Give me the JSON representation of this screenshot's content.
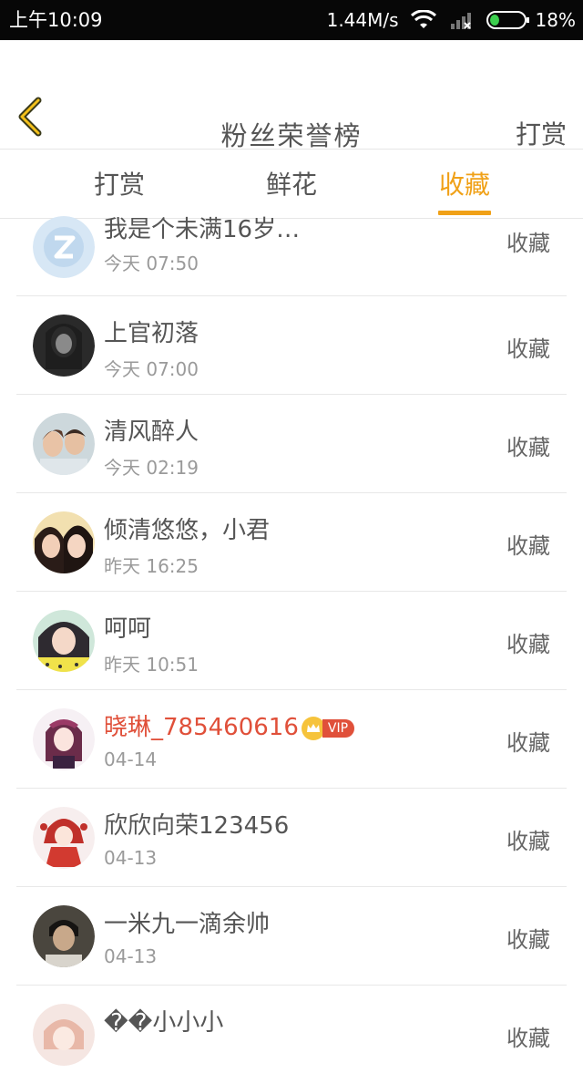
{
  "status_bar": {
    "time": "上午10:09",
    "speed": "1.44M/s",
    "battery": "18%",
    "icons": [
      "wifi-icon",
      "signal-icon",
      "battery-icon"
    ]
  },
  "header": {
    "title": "粉丝荣誉榜",
    "right_action": "打赏",
    "back_icon": "back-chevron-icon"
  },
  "tabs": [
    {
      "label": "打赏",
      "active": false
    },
    {
      "label": "鲜花",
      "active": false
    },
    {
      "label": "收藏",
      "active": true
    }
  ],
  "colors": {
    "accent": "#f0a118",
    "vip_name": "#e0503a",
    "text": "#555555",
    "subtext": "#9a9a9a"
  },
  "items": [
    {
      "name": "我是个未满16岁…",
      "time": "今天 07:50",
      "action": "收藏"
    },
    {
      "name": "上官初落",
      "time": "今天 07:00",
      "action": "收藏"
    },
    {
      "name": "清风醉人",
      "time": "今天 02:19",
      "action": "收藏"
    },
    {
      "name": "倾清悠悠，小君",
      "time": "昨天 16:25",
      "action": "收藏"
    },
    {
      "name": "呵呵",
      "time": "昨天 10:51",
      "action": "收藏"
    },
    {
      "name": "晓琳_785460616",
      "time": "04-14",
      "action": "收藏",
      "vip_badge": "VIP"
    },
    {
      "name": "欣欣向荣123456",
      "time": "04-13",
      "action": "收藏"
    },
    {
      "name": "一米九一滴余帅",
      "time": "04-13",
      "action": "收藏"
    },
    {
      "name": "��小小小",
      "time": "",
      "action": "收藏"
    }
  ]
}
